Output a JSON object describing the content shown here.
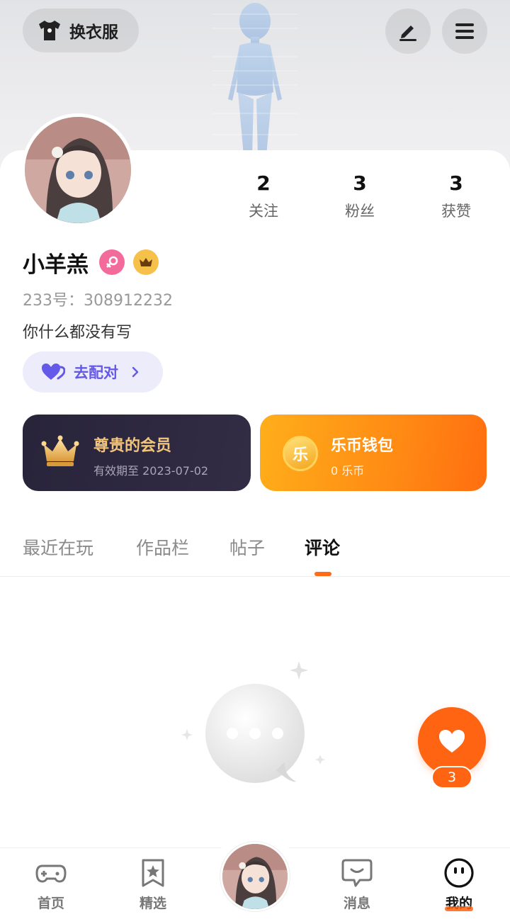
{
  "header": {
    "outfit_button_label": "换衣服",
    "edit_icon": "pen-icon",
    "menu_icon": "hamburger-menu-icon"
  },
  "profile": {
    "stats": [
      {
        "value": "2",
        "label": "关注"
      },
      {
        "value": "3",
        "label": "粉丝"
      },
      {
        "value": "3",
        "label": "获赞"
      }
    ],
    "username": "小羊羔",
    "gender_icon": "female-symbol-icon",
    "vip_icon": "crown-icon",
    "user_id": "233号：308912232",
    "bio": "你什么都没有写",
    "match_button_label": "去配对"
  },
  "cards": {
    "member": {
      "title": "尊贵的会员",
      "subtitle": "有效期至 2023-07-02"
    },
    "wallet": {
      "title": "乐币钱包",
      "subtitle": "0 乐币",
      "coin_glyph": "乐"
    }
  },
  "tabs": [
    {
      "label": "最近在玩",
      "active": false
    },
    {
      "label": "作品栏",
      "active": false
    },
    {
      "label": "帖子",
      "active": false
    },
    {
      "label": "评论",
      "active": true
    }
  ],
  "like_fab": {
    "count": "3",
    "icon": "heart-icon"
  },
  "bottom_nav": [
    {
      "label": "首页",
      "icon": "gamepad-icon",
      "active": false
    },
    {
      "label": "精选",
      "icon": "star-bookmark-icon",
      "active": false
    },
    {
      "label": "消息",
      "icon": "chat-bubble-icon",
      "active": false
    },
    {
      "label": "我的",
      "icon": "face-icon",
      "active": true
    }
  ],
  "colors": {
    "accent_orange": "#ff6412",
    "match_purple": "#6459e8",
    "member_gold": "#f3c57a"
  }
}
